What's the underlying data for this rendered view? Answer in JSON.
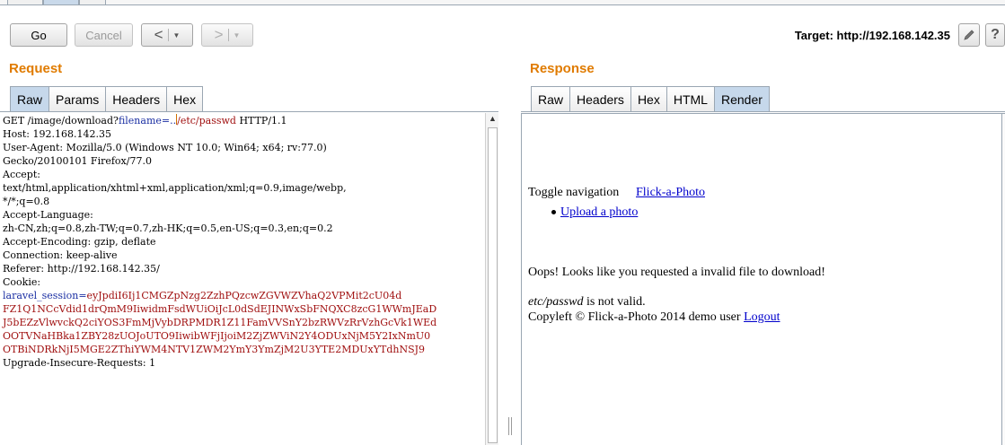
{
  "toolbar": {
    "go_label": "Go",
    "cancel_label": "Cancel",
    "back_glyph": "<",
    "forward_glyph": ">",
    "dropdown_glyph": "▼",
    "target_label": "Target: http://192.168.142.35",
    "edit_icon": "pencil-icon",
    "help_icon": "help-icon",
    "help_glyph": "?"
  },
  "request": {
    "title": "Request",
    "tabs": [
      {
        "label": "Raw",
        "selected": true
      },
      {
        "label": "Params",
        "selected": false
      },
      {
        "label": "Headers",
        "selected": false
      },
      {
        "label": "Hex",
        "selected": false
      }
    ],
    "line1": {
      "method": "GET /image/download?",
      "param_name": "filename",
      "equals": "=..",
      "param_value": "/etc/passwd",
      "protocol": " HTTP/1.1"
    },
    "lines_a": [
      "Host: 192.168.142.35",
      "User-Agent: Mozilla/5.0 (Windows NT 10.0; Win64; x64; rv:77.0)",
      "Gecko/20100101 Firefox/77.0",
      "Accept:",
      "text/html,application/xhtml+xml,application/xml;q=0.9,image/webp,",
      "*/*;q=0.8",
      "Accept-Language:",
      "zh-CN,zh;q=0.8,zh-TW;q=0.7,zh-HK;q=0.5,en-US;q=0.3,en;q=0.2",
      "Accept-Encoding: gzip, deflate",
      "Connection: keep-alive",
      "Referer: http://192.168.142.35/",
      "Cookie:"
    ],
    "cookie_name": "laravel_session",
    "cookie_eq": "=",
    "cookie_value_lines": [
      "eyJpdiI6Ij1CMGZpNzg2ZzhPQzcwZGVWZVhaQ2VPMit2cU04d",
      "FZ1Q1NCcVdid1drQmM9IiwidmFsdWUiOiJcL0dSdEJINWxSbFNQXC8zcG1WWmJEaD",
      "J5bEZzVlwvckQ2ciYOS3FmMjVybDRPMDR1Z11FamVVSnY2bzRWVzRrVzhGcVk1WEd",
      "OOTVNaHBka1ZBY28zUOJoUTO9IiwibWFjIjoiM2ZjZWViN2Y4ODUxNjM5Y2IxNmU0",
      "OTBiNDRkNjI5MGE2ZThiYWM4NTV1ZWM2YmY3YmZjM2U3YTE2MDUxYTdhNSJ9"
    ],
    "last_line": "Upgrade-Insecure-Requests: 1"
  },
  "response": {
    "title": "Response",
    "tabs": [
      {
        "label": "Raw",
        "selected": false
      },
      {
        "label": "Headers",
        "selected": false
      },
      {
        "label": "Hex",
        "selected": false
      },
      {
        "label": "HTML",
        "selected": false
      },
      {
        "label": "Render",
        "selected": true
      }
    ],
    "render": {
      "toggle_nav": "Toggle navigation",
      "brand_link": "Flick-a-Photo",
      "upload_link": "Upload a photo",
      "error_message": "Oops! Looks like you requested a invalid file to download!",
      "file_name": "etc/passwd",
      "not_valid": " is not valid.",
      "copyleft": "Copyleft © Flick-a-Photo 2014  demo user ",
      "logout_link": "Logout"
    }
  },
  "colors": {
    "section_title": "#e07b00",
    "param_blue": "#1b2fa3",
    "value_red": "#a01010",
    "selected_tab": "#c6d8eb",
    "link": "#0000cc"
  }
}
